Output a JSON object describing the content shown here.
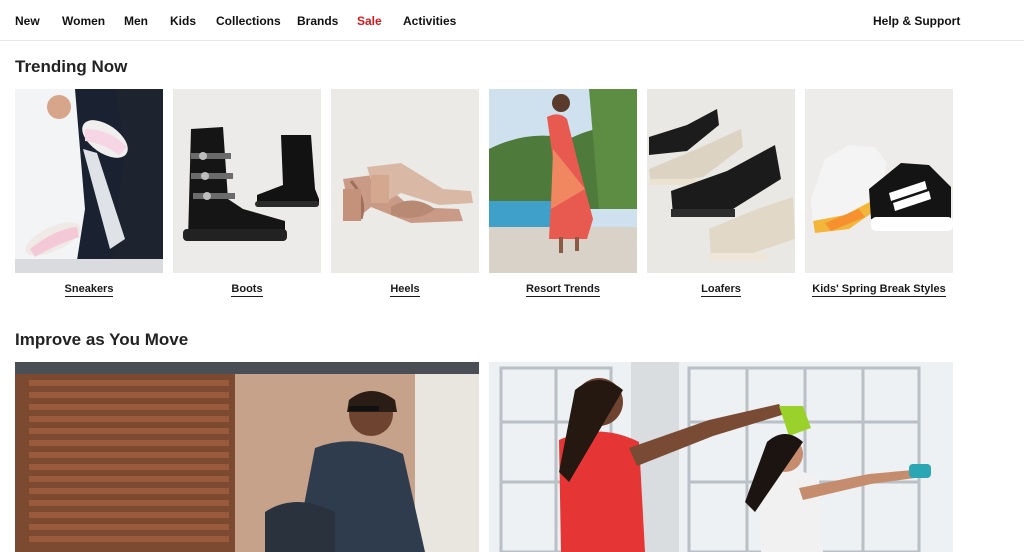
{
  "nav": {
    "items": [
      {
        "label": "New"
      },
      {
        "label": "Women"
      },
      {
        "label": "Men"
      },
      {
        "label": "Kids"
      },
      {
        "label": "Collections"
      },
      {
        "label": "Brands"
      },
      {
        "label": "Sale"
      },
      {
        "label": "Activities"
      }
    ],
    "help_label": "Help & Support",
    "sale_color": "#d4191c"
  },
  "trending": {
    "title": "Trending Now",
    "tiles": [
      {
        "label": "Sneakers",
        "image": "sneakers-photo"
      },
      {
        "label": "Boots",
        "image": "boots-photo"
      },
      {
        "label": "Heels",
        "image": "heels-photo"
      },
      {
        "label": "Resort Trends",
        "image": "resort-photo"
      },
      {
        "label": "Loafers",
        "image": "loafers-photo"
      },
      {
        "label": "Kids' Spring Break Styles",
        "image": "kids-sneakers-photo"
      }
    ]
  },
  "improve": {
    "title": "Improve as You Move",
    "banners": [
      {
        "image": "man-sitting-outdoors-photo"
      },
      {
        "image": "kettlebell-workout-photo"
      }
    ]
  }
}
